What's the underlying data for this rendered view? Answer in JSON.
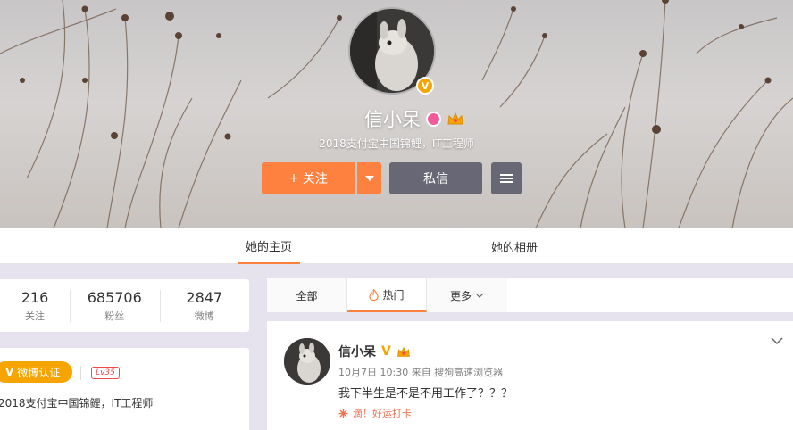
{
  "profile": {
    "name": "信小呆",
    "bio": "2018支付宝中国锦鲤，IT工程师",
    "verified_badge": "V"
  },
  "actions": {
    "follow_label": "关注",
    "follow_plus": "+",
    "message_label": "私信"
  },
  "tabs": {
    "home": "她的主页",
    "album": "她的相册"
  },
  "stats": [
    {
      "num": "216",
      "label": "关注"
    },
    {
      "num": "685706",
      "label": "粉丝"
    },
    {
      "num": "2847",
      "label": "微博"
    }
  ],
  "info": {
    "verify_v": "V",
    "verify_label": "微博认证",
    "level": "Lv35",
    "bio": "2018支付宝中国锦鲤，IT工程师"
  },
  "feed_tabs": {
    "all": "全部",
    "hot": "热门",
    "more": "更多"
  },
  "post": {
    "name": "信小呆",
    "v": "V",
    "meta": "10月7日 10:30 来自 搜狗高速浏览器",
    "text": "我下半生是不是不用工作了？？？",
    "tag": "滴！好运打卡"
  },
  "colors": {
    "accent": "#ff8140",
    "verify": "#f6a400",
    "level": "#f04b4b",
    "button_dark": "#676775",
    "background": "#e6e3ef"
  },
  "icons": [
    "plus-icon",
    "chevron-down-icon",
    "menu-icon",
    "flame-icon",
    "gender-female-icon",
    "crown-icon",
    "flower-icon"
  ]
}
